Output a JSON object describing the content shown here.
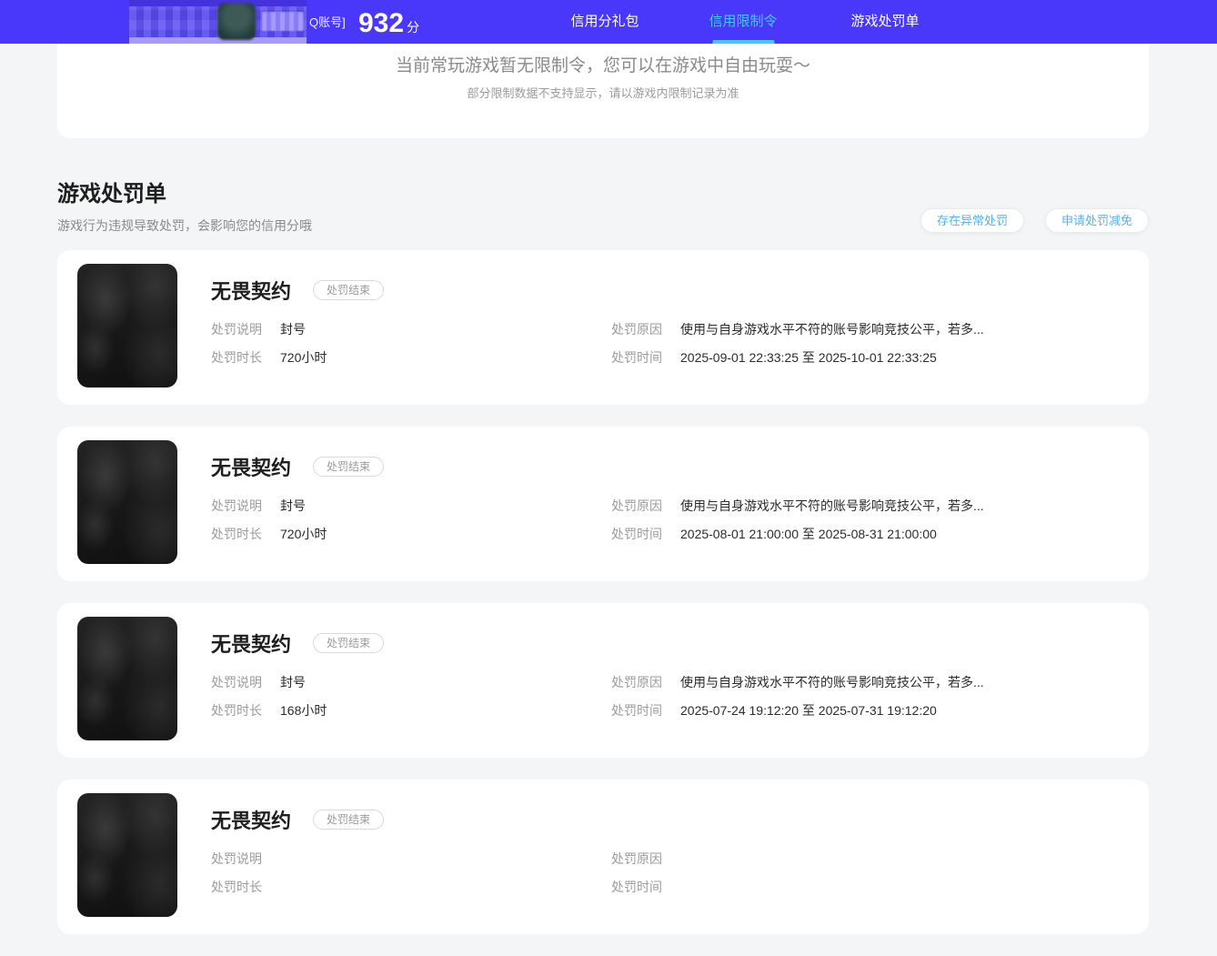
{
  "header": {
    "account_suffix": "Q账号]",
    "score": "932",
    "score_unit": "分",
    "tabs": [
      {
        "label": "信用分礼包",
        "active": false
      },
      {
        "label": "信用限制令",
        "active": true
      },
      {
        "label": "游戏处罚单",
        "active": false
      }
    ]
  },
  "notice": {
    "title": "当前常玩游戏暂无限制令，您可以在游戏中自由玩耍～",
    "subtitle": "部分限制数据不支持显示，请以游戏内限制记录为准"
  },
  "section": {
    "title": "游戏处罚单",
    "subtitle": "游戏行为违规导致处罚，会影响您的信用分哦",
    "buttons": [
      {
        "label": "存在异常处罚"
      },
      {
        "label": "申请处罚减免"
      }
    ]
  },
  "punishments": {
    "field_labels": {
      "desc": "处罚说明",
      "duration": "处罚时长",
      "reason": "处罚原因",
      "time": "处罚时间"
    },
    "cards": [
      {
        "game": "无畏契约",
        "status": "处罚结束",
        "desc": "封号",
        "duration": "720小时",
        "reason": "使用与自身游戏水平不符的账号影响竞技公平，若多...",
        "time": "2025-09-01 22:33:25 至 2025-10-01 22:33:25"
      },
      {
        "game": "无畏契约",
        "status": "处罚结束",
        "desc": "封号",
        "duration": "720小时",
        "reason": "使用与自身游戏水平不符的账号影响竞技公平，若多...",
        "time": "2025-08-01 21:00:00 至 2025-08-31 21:00:00"
      },
      {
        "game": "无畏契约",
        "status": "处罚结束",
        "desc": "封号",
        "duration": "168小时",
        "reason": "使用与自身游戏水平不符的账号影响竞技公平，若多...",
        "time": "2025-07-24 19:12:20 至 2025-07-31 19:12:20"
      },
      {
        "game": "无畏契约",
        "status": "处罚结束"
      }
    ]
  },
  "colors": {
    "header_bg": "#4a38fa",
    "active_tab": "#41c9f7",
    "pill_button_text": "#57b1e8",
    "page_bg": "#f4f5f6"
  }
}
